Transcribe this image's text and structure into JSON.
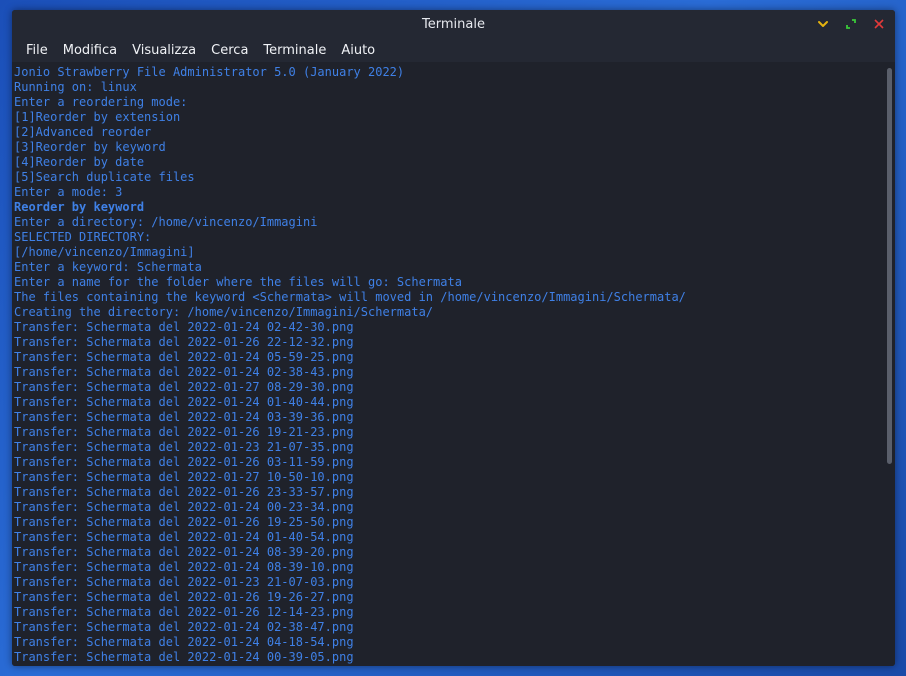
{
  "window": {
    "title": "Terminale",
    "controls": {
      "minimize_icon": "chevron-down-icon",
      "maximize_icon": "expand-icon",
      "close_icon": "close-icon",
      "colors": {
        "minimize": "#e5b30f",
        "maximize": "#3ac93a",
        "close": "#e23a3a"
      }
    }
  },
  "menu": [
    "File",
    "Modifica",
    "Visualizza",
    "Cerca",
    "Terminale",
    "Aiuto"
  ],
  "terminal": {
    "text_color": "#3f80e6",
    "background": "#1f222b",
    "lines": [
      {
        "text": "Jonio Strawberry File Administrator 5.0 (January 2022)",
        "bold": false
      },
      {
        "text": "Running on: linux",
        "bold": false
      },
      {
        "text": "Enter a reordering mode:",
        "bold": false
      },
      {
        "text": "[1]Reorder by extension",
        "bold": false
      },
      {
        "text": "[2]Advanced reorder",
        "bold": false
      },
      {
        "text": "[3]Reorder by keyword",
        "bold": false
      },
      {
        "text": "[4]Reorder by date",
        "bold": false
      },
      {
        "text": "[5]Search duplicate files",
        "bold": false
      },
      {
        "text": "Enter a mode: 3",
        "bold": false
      },
      {
        "text": "Reorder by keyword",
        "bold": true
      },
      {
        "text": "Enter a directory: /home/vincenzo/Immagini",
        "bold": false
      },
      {
        "text": "SELECTED DIRECTORY:",
        "bold": false
      },
      {
        "text": "[/home/vincenzo/Immagini]",
        "bold": false
      },
      {
        "text": "Enter a keyword: Schermata",
        "bold": false
      },
      {
        "text": "Enter a name for the folder where the files will go: Schermata",
        "bold": false
      },
      {
        "text": "The files containing the keyword <Schermata> will moved in /home/vincenzo/Immagini/Schermata/",
        "bold": false
      },
      {
        "text": "Creating the directory: /home/vincenzo/Immagini/Schermata/",
        "bold": false
      },
      {
        "text": "Transfer: Schermata del 2022-01-24 02-42-30.png",
        "bold": false
      },
      {
        "text": "Transfer: Schermata del 2022-01-26 22-12-32.png",
        "bold": false
      },
      {
        "text": "Transfer: Schermata del 2022-01-24 05-59-25.png",
        "bold": false
      },
      {
        "text": "Transfer: Schermata del 2022-01-24 02-38-43.png",
        "bold": false
      },
      {
        "text": "Transfer: Schermata del 2022-01-27 08-29-30.png",
        "bold": false
      },
      {
        "text": "Transfer: Schermata del 2022-01-24 01-40-44.png",
        "bold": false
      },
      {
        "text": "Transfer: Schermata del 2022-01-24 03-39-36.png",
        "bold": false
      },
      {
        "text": "Transfer: Schermata del 2022-01-26 19-21-23.png",
        "bold": false
      },
      {
        "text": "Transfer: Schermata del 2022-01-23 21-07-35.png",
        "bold": false
      },
      {
        "text": "Transfer: Schermata del 2022-01-26 03-11-59.png",
        "bold": false
      },
      {
        "text": "Transfer: Schermata del 2022-01-27 10-50-10.png",
        "bold": false
      },
      {
        "text": "Transfer: Schermata del 2022-01-26 23-33-57.png",
        "bold": false
      },
      {
        "text": "Transfer: Schermata del 2022-01-24 00-23-34.png",
        "bold": false
      },
      {
        "text": "Transfer: Schermata del 2022-01-26 19-25-50.png",
        "bold": false
      },
      {
        "text": "Transfer: Schermata del 2022-01-24 01-40-54.png",
        "bold": false
      },
      {
        "text": "Transfer: Schermata del 2022-01-24 08-39-20.png",
        "bold": false
      },
      {
        "text": "Transfer: Schermata del 2022-01-24 08-39-10.png",
        "bold": false
      },
      {
        "text": "Transfer: Schermata del 2022-01-23 21-07-03.png",
        "bold": false
      },
      {
        "text": "Transfer: Schermata del 2022-01-26 19-26-27.png",
        "bold": false
      },
      {
        "text": "Transfer: Schermata del 2022-01-26 12-14-23.png",
        "bold": false
      },
      {
        "text": "Transfer: Schermata del 2022-01-24 02-38-47.png",
        "bold": false
      },
      {
        "text": "Transfer: Schermata del 2022-01-24 04-18-54.png",
        "bold": false
      },
      {
        "text": "Transfer: Schermata del 2022-01-24 00-39-05.png",
        "bold": false
      }
    ]
  }
}
